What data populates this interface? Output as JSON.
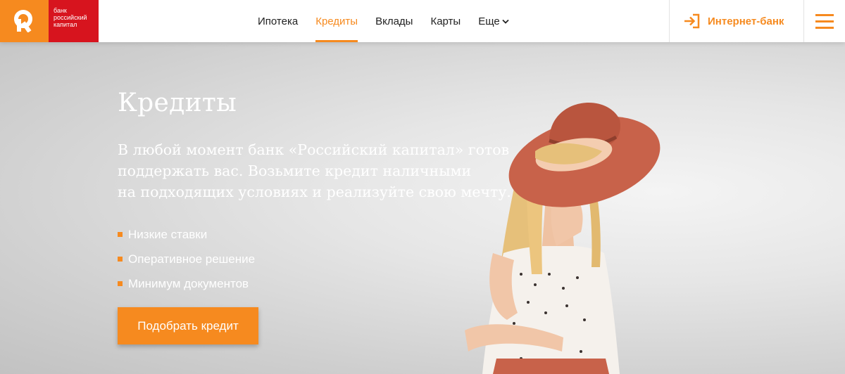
{
  "brand": {
    "logo_lines": [
      "банк",
      "российский",
      "капитал"
    ],
    "colors": {
      "orange": "#f68a1f",
      "red": "#d7141e"
    }
  },
  "nav": {
    "items": [
      {
        "label": "Ипотека",
        "active": false
      },
      {
        "label": "Кредиты",
        "active": true
      },
      {
        "label": "Вклады",
        "active": false
      },
      {
        "label": "Карты",
        "active": false
      },
      {
        "label": "Еще",
        "active": false
      }
    ]
  },
  "header": {
    "internet_bank_label": "Интернет-банк",
    "login_icon": "login-arrow-icon",
    "menu_icon": "hamburger-menu-icon"
  },
  "hero": {
    "title": "Кредиты",
    "description_lines": [
      "В любой момент банк «Российский капитал» готов",
      "поддержать вас. Возьмите кредит наличными",
      "на подходящих условиях и реализуйте свою мечту."
    ],
    "features": [
      "Низкие ставки",
      "Оперативное решение",
      "Минимум документов"
    ],
    "cta_label": "Подобрать кредит"
  }
}
